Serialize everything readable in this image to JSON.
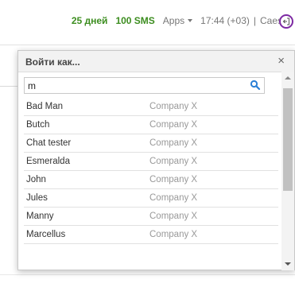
{
  "topbar": {
    "days": "25 дней",
    "sms": "100 SMS",
    "apps_label": "Apps",
    "time": "17:44 (+03)",
    "separator": "|",
    "user_name": "Caesa"
  },
  "dialog": {
    "title": "Войти как...",
    "close_label": "×",
    "search": {
      "value": "m"
    }
  },
  "users": [
    {
      "name": "Bad Man",
      "company": "Company X"
    },
    {
      "name": "Butch",
      "company": "Company X"
    },
    {
      "name": "Chat tester",
      "company": "Company X"
    },
    {
      "name": "Esmeralda",
      "company": "Company X"
    },
    {
      "name": "John",
      "company": "Company X"
    },
    {
      "name": "Jules",
      "company": "Company X"
    },
    {
      "name": "Manny",
      "company": "Company X"
    },
    {
      "name": "Marcellus",
      "company": "Company X"
    }
  ],
  "colors": {
    "green": "#3c8d1f",
    "accent_purple": "#7d2aa3",
    "search_blue": "#2a7fd6"
  },
  "icons": {
    "search": "search-icon",
    "logout": "logout-icon",
    "apps_caret": "caret-down-icon"
  }
}
